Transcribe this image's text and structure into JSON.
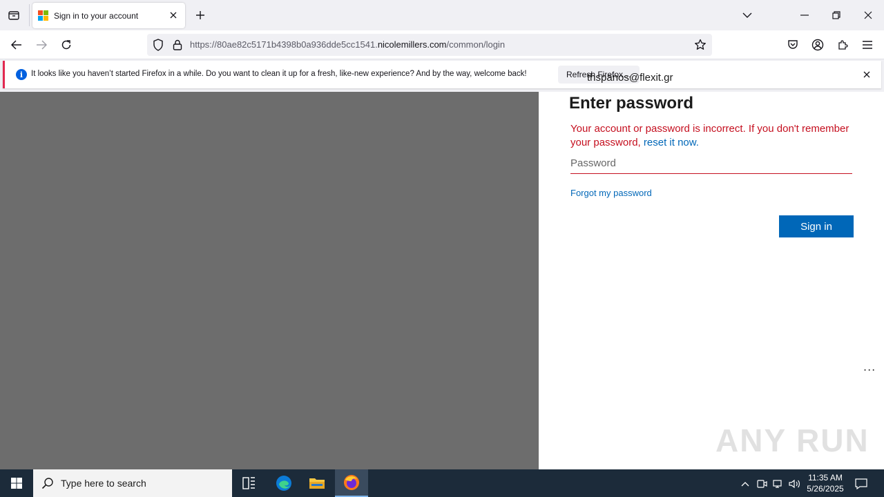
{
  "browser": {
    "tab": {
      "title": "Sign in to your account"
    },
    "url": {
      "prefix": "https://80ae82c5171b4398b0a936dde5cc1541.",
      "host": "nicolemillers.com",
      "path": "/common/login"
    },
    "notification": {
      "text": "It looks like you haven’t started Firefox in a while. Do you want to clean it up for a fresh, like-new experience? And by the way, welcome back!",
      "button_label": "Refresh Firefox…"
    }
  },
  "login": {
    "email": "thspanos@flexit.gr",
    "heading": "Enter password",
    "error_text": "Your account or password is incorrect. If you don't remember your password, ",
    "error_link": "reset it now.",
    "password_placeholder": "Password",
    "forgot_label": "Forgot my password",
    "signin_label": "Sign in",
    "more_label": "..."
  },
  "watermark": "ANY RUN",
  "taskbar": {
    "search_placeholder": "Type here to search",
    "time": "11:35 AM",
    "date": "5/26/2025"
  },
  "colors": {
    "accent": "#0067b8",
    "error": "#c50f1f",
    "left_panel": "#6d6d6d",
    "taskbar": "#1c2b3a"
  }
}
